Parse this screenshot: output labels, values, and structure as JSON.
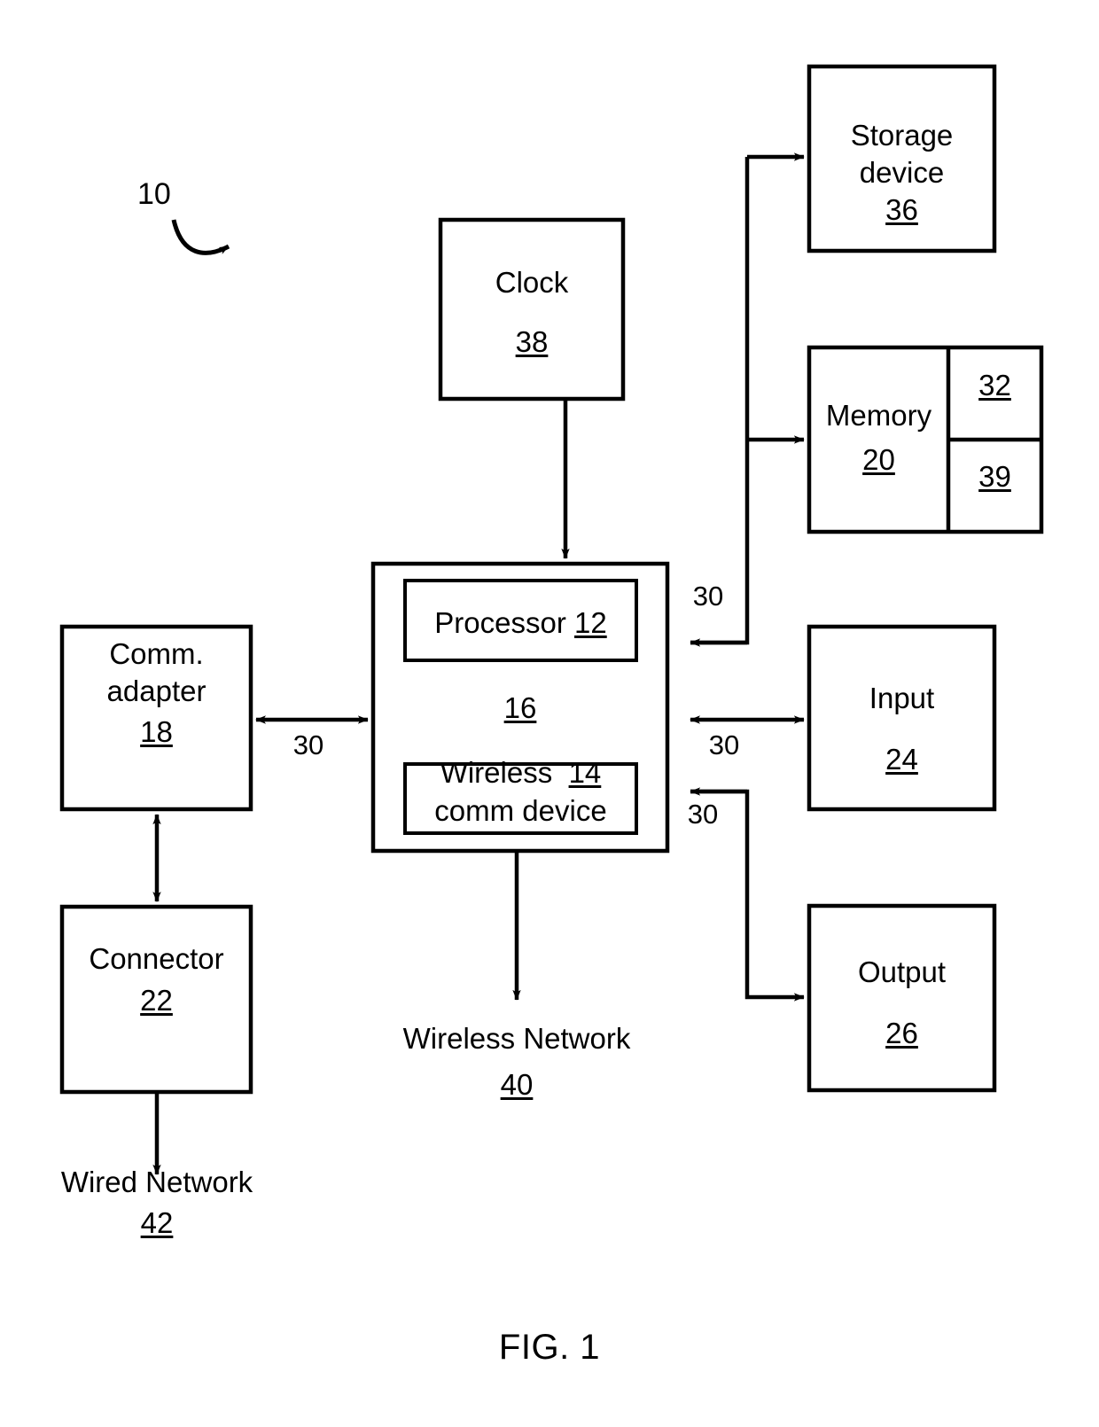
{
  "figure": {
    "caption": "FIG. 1",
    "system_callout": "10"
  },
  "blocks": {
    "clock": {
      "title": "Clock",
      "ref": "38"
    },
    "storage_device": {
      "title_line1": "Storage",
      "title_line2": "device",
      "ref": "36"
    },
    "memory": {
      "title": "Memory",
      "ref": "20",
      "cell_top_ref": "32",
      "cell_bottom_ref": "39"
    },
    "system_unit": {
      "ref": "16"
    },
    "processor": {
      "title": "Processor",
      "ref": "12"
    },
    "wireless_comm_device": {
      "title_line1": "Wireless",
      "title_line2": "comm device",
      "ref": "14"
    },
    "comm_adapter": {
      "title_line1": "Comm.",
      "title_line2": "adapter",
      "ref": "18"
    },
    "connector": {
      "title": "Connector",
      "ref": "22"
    },
    "input": {
      "title": "Input",
      "ref": "24"
    },
    "output": {
      "title": "Output",
      "ref": "26"
    }
  },
  "endpoints": {
    "wireless_network": {
      "title": "Wireless Network",
      "ref": "40"
    },
    "wired_network": {
      "title": "Wired Network",
      "ref": "42"
    }
  },
  "bus_labels": {
    "comm_adapter_bus": "30",
    "storage_memory_bus": "30",
    "input_bus": "30",
    "output_bus": "30"
  },
  "colors": {
    "stroke": "#000000",
    "background": "#ffffff"
  }
}
